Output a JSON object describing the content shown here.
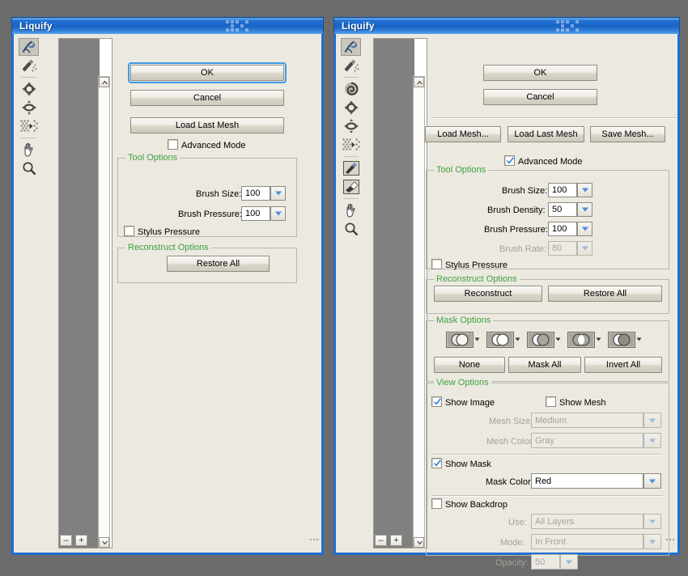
{
  "app": {
    "title": "Liquify"
  },
  "left_dialog": {
    "title": "Liquify",
    "tools": [
      {
        "name": "forward-warp-tool",
        "selected": true
      },
      {
        "name": "reconstruct-tool",
        "selected": false
      },
      {
        "name": "pucker-tool",
        "selected": false
      },
      {
        "name": "bloat-tool",
        "selected": false
      },
      {
        "name": "shift-pixels-tool",
        "selected": false
      },
      {
        "name": "hand-tool",
        "selected": false
      },
      {
        "name": "zoom-tool",
        "selected": false
      }
    ],
    "buttons": {
      "ok": "OK",
      "cancel": "Cancel",
      "load_last_mesh": "Load Last Mesh",
      "restore_all": "Restore All"
    },
    "advanced_mode": {
      "label": "Advanced Mode",
      "checked": false
    },
    "tool_options": {
      "legend": "Tool Options",
      "brush_size_label": "Brush Size:",
      "brush_size_value": "100",
      "brush_pressure_label": "Brush Pressure:",
      "brush_pressure_value": "100",
      "stylus_pressure_label": "Stylus Pressure",
      "stylus_pressure_checked": false
    },
    "reconstruct_options": {
      "legend": "Reconstruct Options"
    },
    "zoom_out_label": "–",
    "zoom_in_label": "+"
  },
  "right_dialog": {
    "title": "Liquify",
    "tools": [
      {
        "name": "forward-warp-tool",
        "selected": true
      },
      {
        "name": "reconstruct-tool",
        "selected": false
      },
      {
        "name": "twirl-clockwise-tool",
        "selected": false
      },
      {
        "name": "pucker-tool",
        "selected": false
      },
      {
        "name": "bloat-tool",
        "selected": false
      },
      {
        "name": "shift-pixels-tool",
        "selected": false
      },
      {
        "name": "freeze-mask-tool",
        "selected": false
      },
      {
        "name": "thaw-mask-tool",
        "selected": false
      },
      {
        "name": "hand-tool",
        "selected": false
      },
      {
        "name": "zoom-tool",
        "selected": false
      }
    ],
    "buttons": {
      "ok": "OK",
      "cancel": "Cancel",
      "load_mesh": "Load Mesh...",
      "load_last_mesh": "Load Last Mesh",
      "save_mesh": "Save Mesh...",
      "reconstruct": "Reconstruct",
      "restore_all": "Restore All",
      "mask_none": "None",
      "mask_all": "Mask All",
      "invert_all": "Invert All"
    },
    "advanced_mode": {
      "label": "Advanced Mode",
      "checked": true
    },
    "tool_options": {
      "legend": "Tool Options",
      "brush_size_label": "Brush Size:",
      "brush_size_value": "100",
      "brush_density_label": "Brush Density:",
      "brush_density_value": "50",
      "brush_pressure_label": "Brush Pressure:",
      "brush_pressure_value": "100",
      "brush_rate_label": "Brush Rate:",
      "brush_rate_value": "80",
      "brush_rate_disabled": true,
      "stylus_pressure_label": "Stylus Pressure",
      "stylus_pressure_checked": false
    },
    "reconstruct_options": {
      "legend": "Reconstruct Options"
    },
    "mask_options": {
      "legend": "Mask Options",
      "icons": [
        {
          "name": "mask-replace-selection-icon"
        },
        {
          "name": "mask-add-to-selection-icon"
        },
        {
          "name": "mask-subtract-from-selection-icon"
        },
        {
          "name": "mask-intersect-with-selection-icon"
        },
        {
          "name": "mask-invert-selection-icon"
        }
      ]
    },
    "view_options": {
      "legend": "View Options",
      "show_image_label": "Show Image",
      "show_image_checked": true,
      "show_mesh_label": "Show Mesh",
      "show_mesh_checked": false,
      "mesh_size_label": "Mesh Size:",
      "mesh_size_value": "Medium",
      "mesh_color_label": "Mesh Color:",
      "mesh_color_value": "Gray",
      "show_mask_label": "Show Mask",
      "show_mask_checked": true,
      "mask_color_label": "Mask Color:",
      "mask_color_value": "Red",
      "show_backdrop_label": "Show Backdrop",
      "show_backdrop_checked": false,
      "use_label": "Use:",
      "use_value": "All Layers",
      "mode_label": "Mode:",
      "mode_value": "In Front",
      "opacity_label": "Opacity:",
      "opacity_value": "50"
    },
    "zoom_out_label": "–",
    "zoom_in_label": "+"
  },
  "colors": {
    "desktop": "#6b6b6b",
    "dialog_face": "#ece9e0",
    "title_blue": "#1f6fd2",
    "group_legend_green": "#3fa03f",
    "preview_gray": "#808080",
    "focus_blue": "#3d9ae8"
  }
}
